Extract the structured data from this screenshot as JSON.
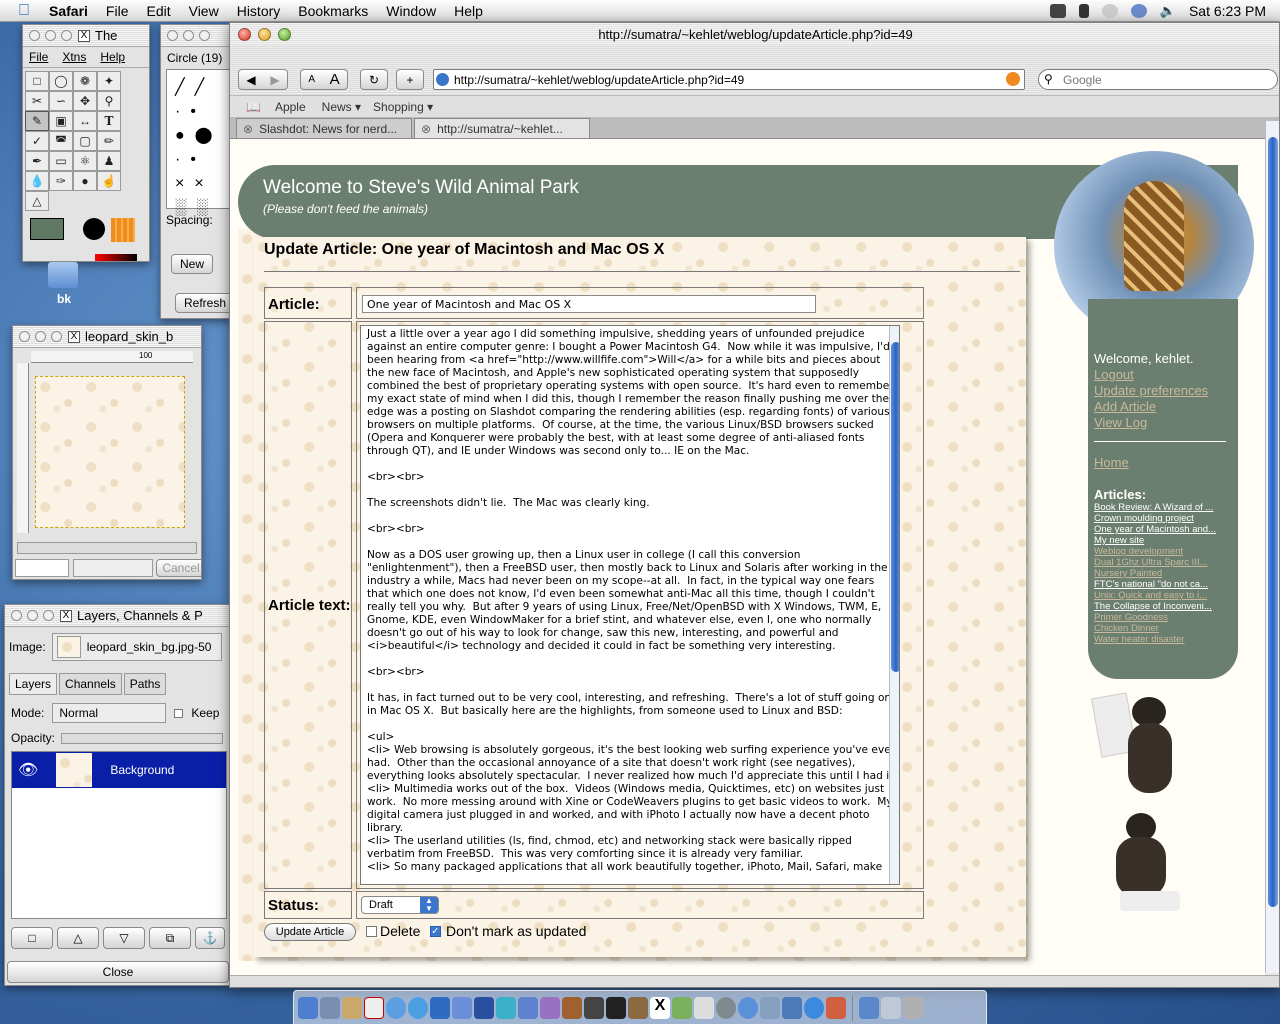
{
  "menubar": {
    "app": "Safari",
    "items": [
      "File",
      "Edit",
      "View",
      "History",
      "Bookmarks",
      "Window",
      "Help"
    ],
    "clock": "Sat 6:23 PM"
  },
  "toolbox": {
    "title": "The",
    "menus": [
      "File",
      "Xtns",
      "Help"
    ]
  },
  "brushes": {
    "title": "Circle (19)",
    "spacing_label": "Spacing:",
    "new_btn": "New",
    "refresh_btn": "Refresh"
  },
  "desktop": {
    "folder_label": "bk"
  },
  "image_window": {
    "title": "leopard_skin_b",
    "ruler_top": "100",
    "cancel_btn": "Cancel"
  },
  "layers": {
    "title": "Layers, Channels & P",
    "image_label": "Image:",
    "image_value": "leopard_skin_bg.jpg-50",
    "tabs": [
      "Layers",
      "Channels",
      "Paths"
    ],
    "mode_label": "Mode:",
    "mode_value": "Normal",
    "keep_label": "Keep",
    "opacity_label": "Opacity:",
    "layer_name": "Background",
    "close_btn": "Close"
  },
  "safari": {
    "title": "http://sumatra/~kehlet/weblog/updateArticle.php?id=49",
    "url": "http://sumatra/~kehlet/weblog/updateArticle.php?id=49",
    "search_placeholder": "Google",
    "bookmarks": [
      "Apple",
      "News ▾",
      "Shopping ▾"
    ],
    "tabs": [
      "Slashdot: News for nerd...",
      "http://sumatra/~kehlet..."
    ]
  },
  "page": {
    "banner_title": "Welcome to Steve's Wild Animal Park",
    "banner_subtitle": "(Please don't feed the animals)",
    "heading": "Update Article: One year of Macintosh and Mac OS X",
    "article_label": "Article:",
    "article_value": "One year of Macintosh and Mac OS X",
    "text_label": "Article text:",
    "article_text": "Just a little over a year ago I did something impulsive, shedding years of unfounded prejudice against an entire computer genre: I bought a Power Macintosh G4.  Now while it was impulsive, I'd been hearing from <a href=\"http://www.willfife.com\">Will</a> for a while bits and pieces about the new face of Macintosh, and Apple's new sophisticated operating system that supposedly combined the best of proprietary operating systems with open source.  It's hard even to remember my exact state of mind when I did this, though I remember the reason finally pushing me over the edge was a posting on Slashdot comparing the rendering abilities (esp. regarding fonts) of various browsers on multiple platforms.  Of course, at the time, the various Linux/BSD browsers sucked (Opera and Konquerer were probably the best, with at least some degree of anti-aliased fonts through QT), and IE under Windows was second only to... IE on the Mac.\n\n<br><br>\n\nThe screenshots didn't lie.  The Mac was clearly king.\n\n<br><br>\n\nNow as a DOS user growing up, then a Linux user in college (I call this conversion \"enlightenment\"), then a FreeBSD user, then mostly back to Linux and Solaris after working in the industry a while, Macs had never been on my scope--at all.  In fact, in the typical way one fears that which one does not know, I'd even been somewhat anti-Mac all this time, though I couldn't really tell you why.  But after 9 years of using Linux, Free/Net/OpenBSD with X Windows, TWM, E, Gnome, KDE, even WindowMaker for a brief stint, and whatever else, even I, one who normally doesn't go out of his way to look for change, saw this new, interesting, and powerful and <i>beautiful</i> technology and decided it could in fact be something very interesting.\n\n<br><br>\n\nIt has, in fact turned out to be very cool, interesting, and refreshing.  There's a lot of stuff going on in Mac OS X.  But basically here are the highlights, from someone used to Linux and BSD:\n\n<ul>\n<li> Web browsing is absolutely gorgeous, it's the best looking web surfing experience you've ever had.  Other than the occasional annoyance of a site that doesn't work right (see negatives), everything looks absolutely spectacular.  I never realized how much I'd appreciate this until I had it.\n<li> Multimedia works out of the box.  Videos (Windows media, Quicktimes, etc) on websites just work.  No more messing around with Xine or CodeWeavers plugins to get basic videos to work.  My digital camera just plugged in and worked, and with iPhoto I actually now have a decent photo library.\n<li> The userland utilities (ls, find, chmod, etc) and networking stack were basically ripped verbatim from FreeBSD.  This was very comforting since it is already very familiar.\n<li> So many packaged applications that all work beautifully together, iPhoto, Mail, Safari, make",
    "status_label": "Status:",
    "status_value": "Draft",
    "update_btn": "Update Article",
    "delete_label": "Delete",
    "dont_mark_label": "Don't mark as updated",
    "delete_checked": false,
    "dont_mark_checked": true
  },
  "sidebar": {
    "welcome": "Welcome, kehlet.",
    "links": [
      "Logout",
      "Update preferences",
      "Add Article",
      "View Log"
    ],
    "home": "Home",
    "articles_heading": "Articles:",
    "articles": [
      "Book Review: A Wizard of ...",
      "Crown moulding project",
      "One year of Macintosh and...",
      "My new site",
      "Weblog development",
      "Dual 1Ghz Ultra Sparc III...",
      "Nursery Painted",
      "FTC's national \"do not ca...",
      "Unix: Quick and easy to i...",
      "The Collapse of Inconveni...",
      "Primer Goodness",
      "Chicken Dinner",
      "Water heater disaster"
    ]
  }
}
